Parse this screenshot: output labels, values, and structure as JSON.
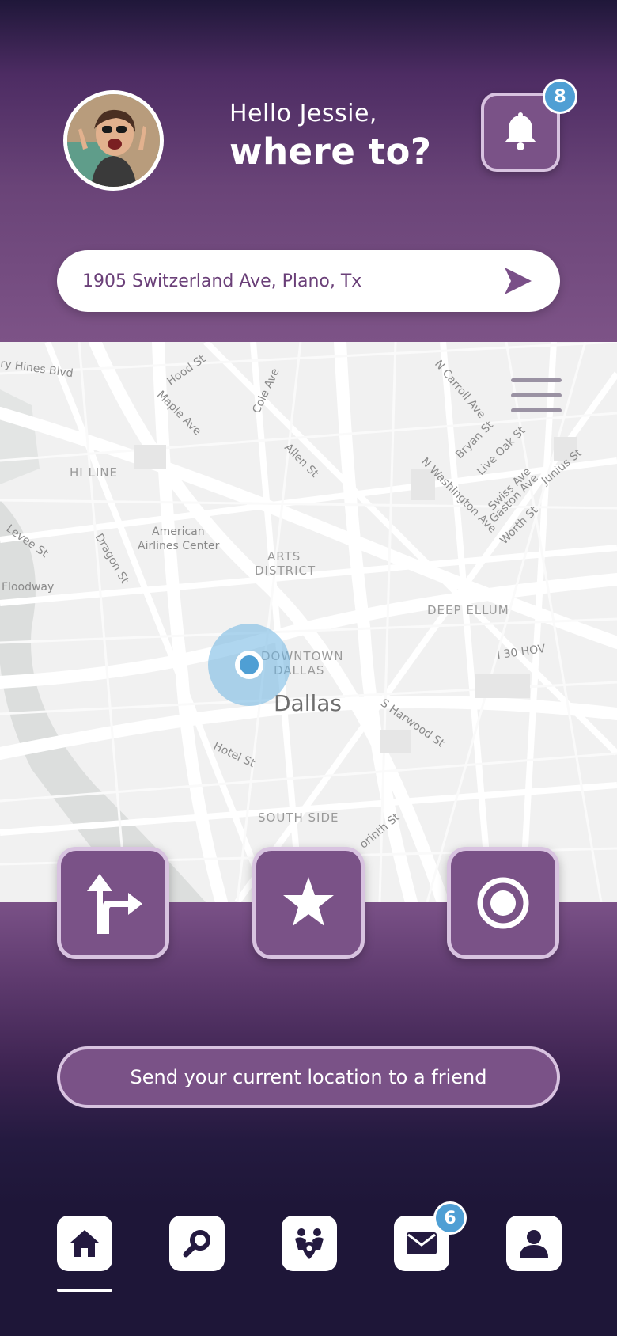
{
  "header": {
    "greeting": "Hello Jessie,",
    "question": "where to?",
    "notifications_count": "8"
  },
  "search": {
    "value": "1905 Switzerland Ave, Plano, Tx"
  },
  "map": {
    "labels": {
      "hines": "ry Hines Blvd",
      "hood": "Hood St",
      "maple": "Maple Ave",
      "cole": "Cole Ave",
      "ncarroll": "N Carroll Ave",
      "bryan": "Bryan St",
      "liveoak": "Live Oak St",
      "junius": "Junius St",
      "allen": "Allen St",
      "hiline": "HI LINE",
      "nwashington": "N Washington Ave",
      "swiss": "Swiss Ave",
      "gaston": "Gaston Ave",
      "worth": "Worth St",
      "levee": "Levee St",
      "dragon": "Dragon St",
      "aac1": "American",
      "aac2": "Airlines Center",
      "arts1": "ARTS",
      "arts2": "DISTRICT",
      "floodway": "Floodway",
      "deepellum": "DEEP ELLUM",
      "downtown1": "DOWNTOWN",
      "downtown2": "DALLAS",
      "i30": "I 30 HOV",
      "dallas": "Dallas",
      "harwood": "S Harwood St",
      "hotel": "Hotel St",
      "southside": "SOUTH SIDE",
      "corinth": "orinth St"
    }
  },
  "actions": {
    "share_label": "Send your current location to a friend"
  },
  "nav": {
    "mail_count": "6"
  },
  "colors": {
    "brand_purple": "#7a5287",
    "badge_blue": "#4f9fd4",
    "dark_bg": "#1e1638"
  }
}
